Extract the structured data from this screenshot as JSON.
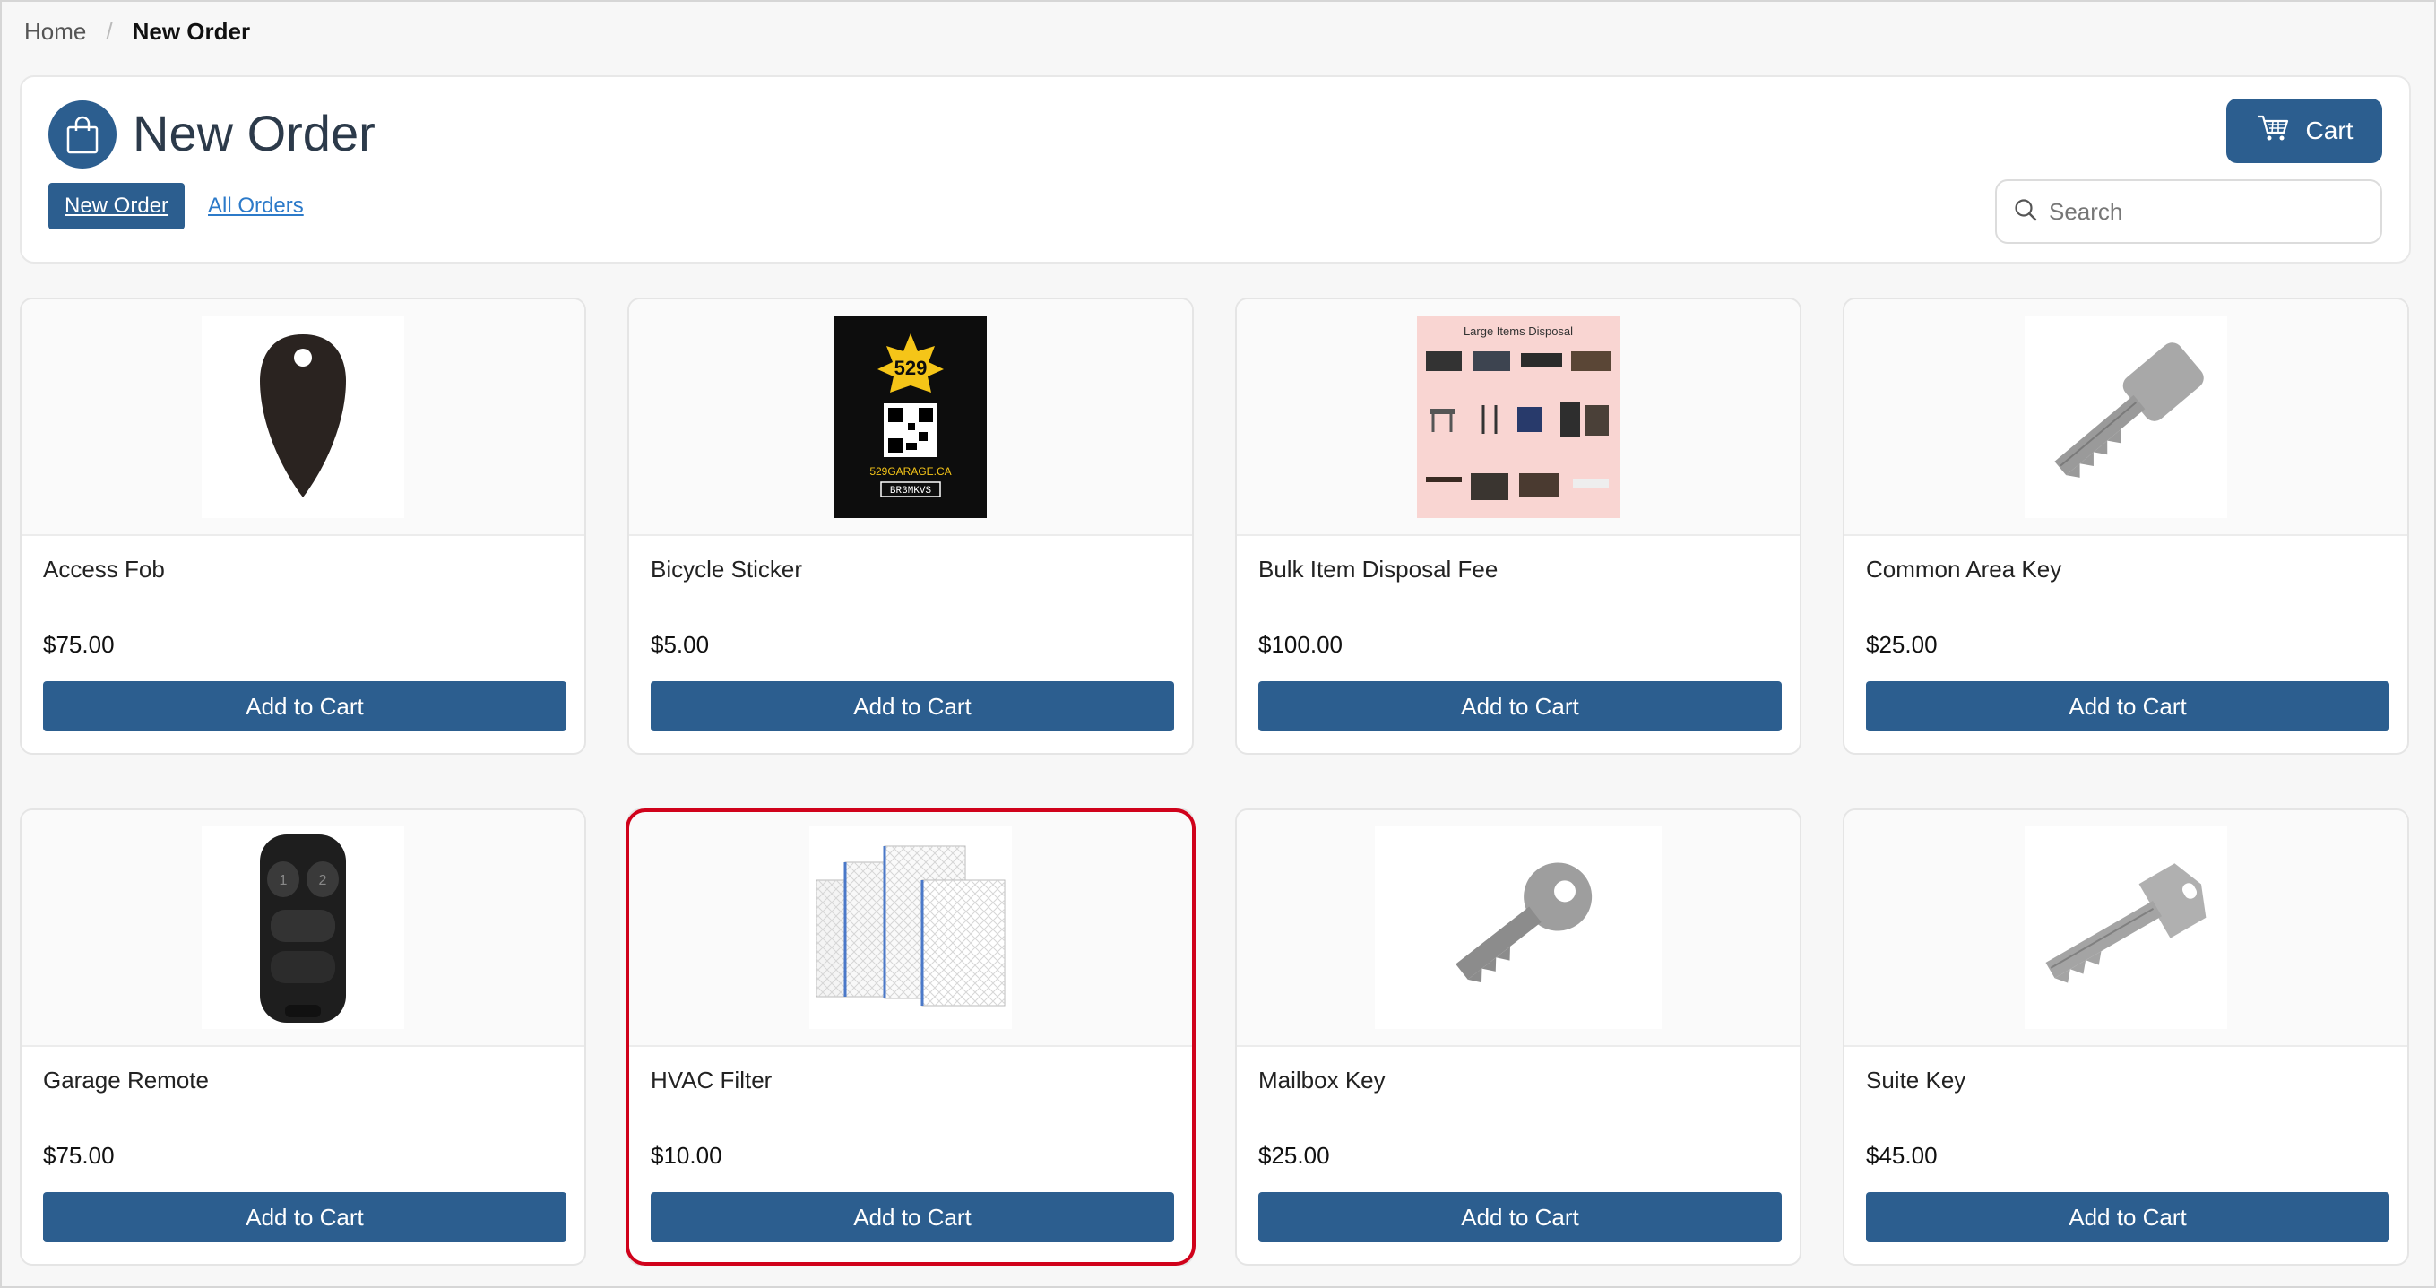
{
  "breadcrumb": {
    "home": "Home",
    "separator": "/",
    "current": "New Order"
  },
  "header": {
    "title": "New Order",
    "tabs": [
      {
        "label": "New Order",
        "active": true
      },
      {
        "label": "All Orders",
        "active": false
      }
    ],
    "cart_label": "Cart",
    "search_placeholder": "Search"
  },
  "colors": {
    "primary": "#2c5e8f",
    "link": "#2c7ac9",
    "highlight": "#d0021b"
  },
  "products": [
    {
      "name": "Access Fob",
      "price": "$75.00",
      "button": "Add to Cart",
      "icon": "access-fob-image"
    },
    {
      "name": "Bicycle Sticker",
      "price": "$5.00",
      "button": "Add to Cart",
      "icon": "bicycle-sticker-image",
      "sticker_top": "529",
      "sticker_bottom": "529GARAGE.CA",
      "sticker_code": "BR3MKVS"
    },
    {
      "name": "Bulk Item Disposal Fee",
      "price": "$100.00",
      "button": "Add to Cart",
      "icon": "bulk-disposal-image",
      "poster_title": "Large Items Disposal"
    },
    {
      "name": "Common Area Key",
      "price": "$25.00",
      "button": "Add to Cart",
      "icon": "key-image"
    },
    {
      "name": "Garage Remote",
      "price": "$75.00",
      "button": "Add to Cart",
      "icon": "garage-remote-image"
    },
    {
      "name": "HVAC Filter",
      "price": "$10.00",
      "button": "Add to Cart",
      "icon": "hvac-filter-image"
    },
    {
      "name": "Mailbox Key",
      "price": "$25.00",
      "button": "Add to Cart",
      "icon": "mailbox-key-image"
    },
    {
      "name": "Suite Key",
      "price": "$45.00",
      "button": "Add to Cart",
      "icon": "suite-key-image"
    }
  ]
}
